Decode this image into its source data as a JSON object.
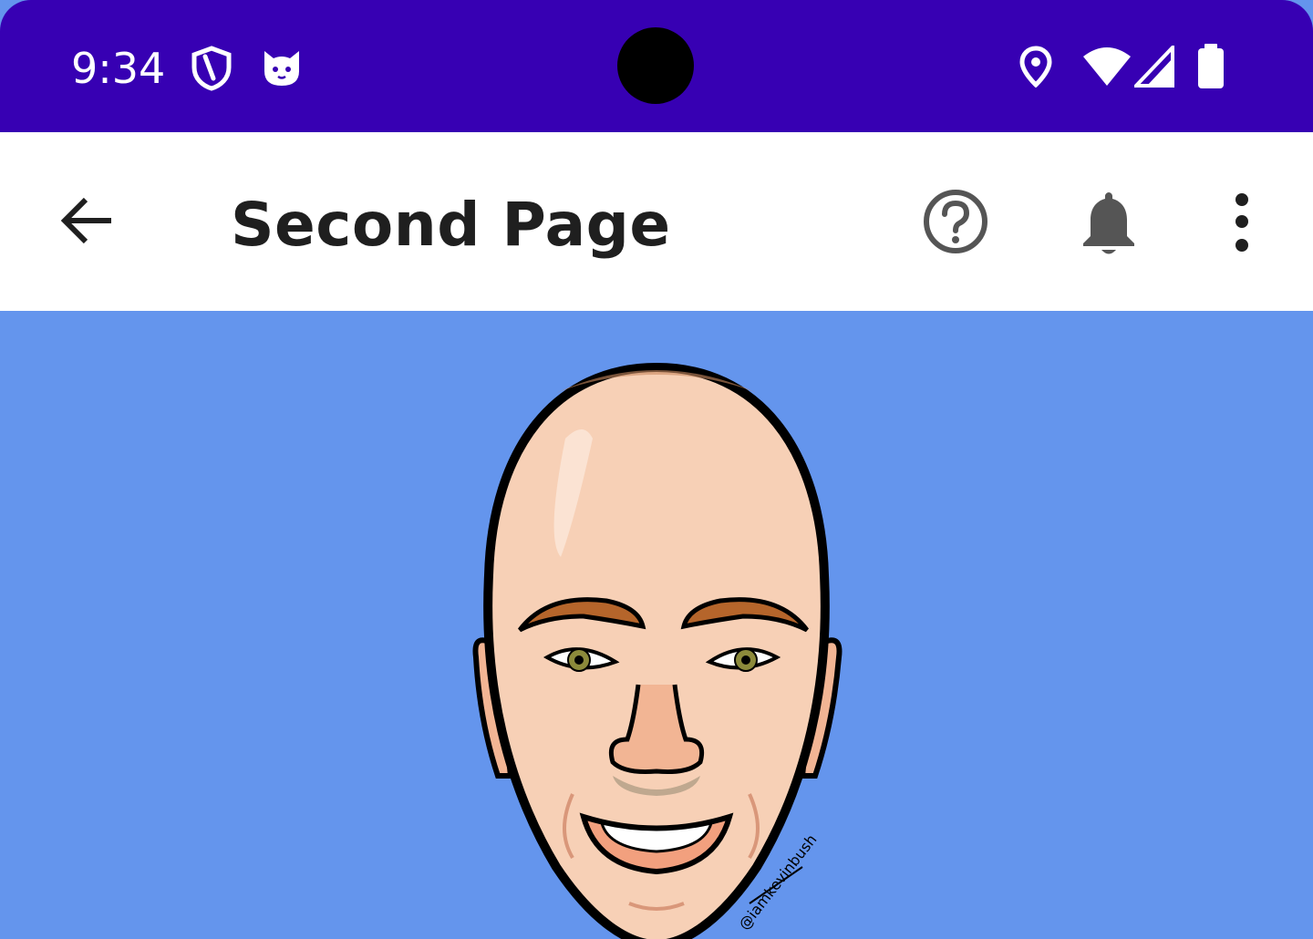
{
  "status_bar": {
    "time": "9:34",
    "background_color": "#3700B3",
    "left_icons": [
      "shield-icon",
      "cat-face-icon"
    ],
    "right_icons": [
      "location-icon",
      "wifi-icon",
      "signal-icon",
      "battery-icon"
    ]
  },
  "app_bar": {
    "title": "Second Page",
    "back_icon": "arrow-back-icon",
    "actions": [
      "help-icon",
      "notifications-icon",
      "more-vert-icon"
    ]
  },
  "content": {
    "background_color": "#6495ED",
    "image": "caricature-avatar",
    "signature": "@iamkevinbush"
  }
}
